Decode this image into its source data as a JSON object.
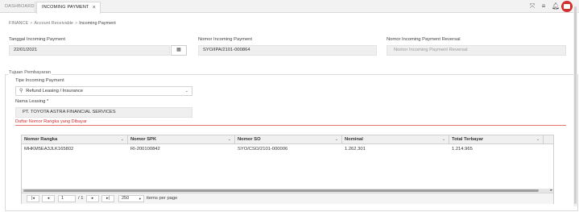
{
  "tabs": [
    {
      "label": "DASHBOARD"
    },
    {
      "label": "INCOMING PAYMENT",
      "close": "×"
    }
  ],
  "topbar_icons": [
    "expand-icon",
    "menu-icon",
    "bell-icon",
    "avatar"
  ],
  "breadcrumb": {
    "items": [
      "FINANCE",
      "Account Receivable",
      "Incoming Payment"
    ],
    "separator": ">"
  },
  "form": {
    "tanggal": {
      "label": "Tanggal Incoming Payment",
      "value": "22/01/2021"
    },
    "nomor": {
      "label": "Nomor Incoming Payment",
      "value": "SYO/IPA/2101-000864"
    },
    "reversal": {
      "label": "Nomor Incoming Payment Reversal",
      "placeholder": "Nomor Incoming Payment Reversal"
    }
  },
  "tujuan": {
    "legend": "Tujuan Pembayaran",
    "tipe_label": "Tipe Incoming Payment",
    "tipe_value": "Refund Leasing / Insurance",
    "leasing_label": "Nama Leasing *",
    "leasing_value": "PT. TOYOTA ASTRA FINANCIAL SERVICES",
    "daftar_link": "Daftar Nomor Rangka yang Dibayar"
  },
  "grid": {
    "columns": [
      "Nomor Rangka",
      "Nomor SPK",
      "Nomor SO",
      "Nominal",
      "Total Terbayar"
    ],
    "rows": [
      [
        "MHKM5EA3JLK165802",
        "RI-200100842",
        "SYO/CSO/2101-000006",
        "1.262.301",
        "1.214.965"
      ]
    ]
  },
  "pager": {
    "page": "1",
    "of_text": "/ 1",
    "page_size": "250",
    "items_label": "items per page"
  },
  "colors": {
    "accent_red": "#d32f2f",
    "field_bg": "#efefef"
  }
}
